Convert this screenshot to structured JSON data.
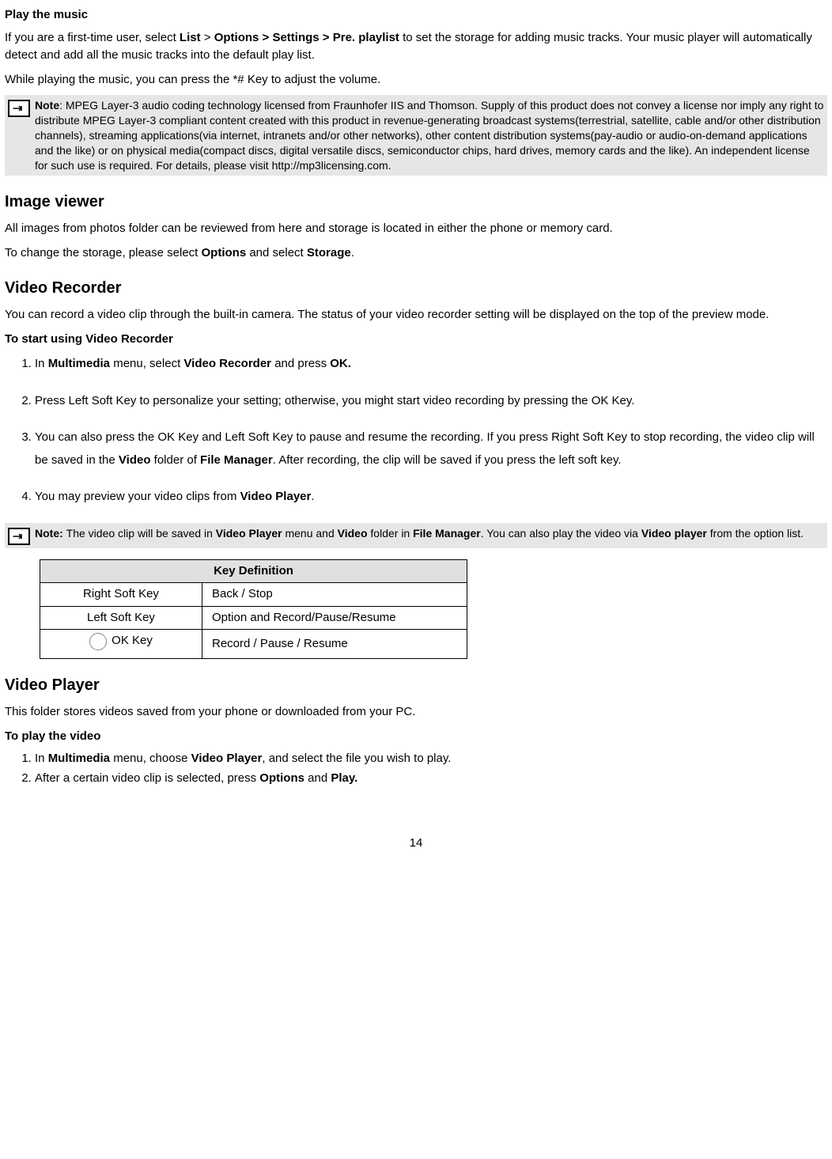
{
  "play_music": {
    "heading": "Play the music",
    "intro_1a": "If you are a first-time user, select ",
    "intro_1b": "List",
    "intro_1c": " > ",
    "intro_1d": "Options > Settings > Pre. playlist",
    "intro_1e": " to set the storage for adding music tracks. Your music player will automatically detect and add all the music tracks into the default play list.",
    "intro_2": "While playing the music, you can press the *# Key to adjust the volume.",
    "note_label": "Note",
    "note_sep": ":  ",
    "note_text": "MPEG Layer-3 audio coding technology licensed from Fraunhofer IIS and Thomson. Supply of this product does not convey a license nor imply any right to distribute MPEG Layer-3 compliant content created with this product in revenue-generating broadcast systems(terrestrial, satellite, cable and/or other distribution channels), streaming applications(via internet, intranets and/or other networks), other content distribution systems(pay-audio or audio-on-demand applications and the like) or on physical media(compact discs, digital versatile discs, semiconductor chips, hard drives, memory cards and the like). An independent license for such use is required. For details, please visit http://mp3licensing.com."
  },
  "image_viewer": {
    "heading": "Image viewer",
    "p1": "All images from photos folder can be reviewed from here and storage is located in either the phone or memory card.",
    "p2a": "To change the storage, please select ",
    "p2b": "Options",
    "p2c": " and select ",
    "p2d": "Storage",
    "p2e": "."
  },
  "video_recorder": {
    "heading": "Video Recorder",
    "intro": "You can record a video clip through the built-in camera. The status of your video recorder setting will be displayed on the top of the preview mode.",
    "subheading": "To start using Video Recorder",
    "li1a": "In ",
    "li1b": "Multimedia",
    "li1c": " menu, select ",
    "li1d": "Video Recorder",
    "li1e": " and press ",
    "li1f": "OK.",
    "li2": "Press Left Soft Key to personalize your setting; otherwise, you might start video recording by pressing the OK Key.",
    "li3a": "You can also press the OK Key and Left Soft Key to pause and resume the recording. If you press Right Soft Key to stop recording, the video clip will be saved in the ",
    "li3b": "Video",
    "li3c": " folder of ",
    "li3d": "File Manager",
    "li3e": ". After recording, the clip will be saved if you press the left soft key.",
    "li4a": "You may preview your video clips from ",
    "li4b": "Video Player",
    "li4c": ".",
    "note_label": "Note: ",
    "note_a": "The video clip will be saved in ",
    "note_b": "Video Player",
    "note_c": " menu and ",
    "note_d": "Video",
    "note_e": " folder in ",
    "note_f": "File Manager",
    "note_g": ". You can also play the video via ",
    "note_h": "Video player",
    "note_i": " from the option list."
  },
  "key_table": {
    "header": "Key Definition",
    "rows": [
      {
        "key": "Right Soft Key",
        "def": "Back / Stop"
      },
      {
        "key": "Left Soft Key",
        "def": "Option and Record/Pause/Resume"
      },
      {
        "key": "OK Key",
        "def": "Record / Pause / Resume"
      }
    ]
  },
  "video_player": {
    "heading": "Video Player",
    "intro": "This folder stores videos saved from your phone or downloaded from your PC.",
    "subheading": "To play the video",
    "li1a": "In ",
    "li1b": "Multimedia",
    "li1c": " menu, choose ",
    "li1d": "Video Player",
    "li1e": ", and select the file you wish to play.",
    "li2a": "After a certain video clip is selected, press ",
    "li2b": "Options",
    "li2c": " and ",
    "li2d": "Play.",
    "li2e": ""
  },
  "page_number": "14"
}
